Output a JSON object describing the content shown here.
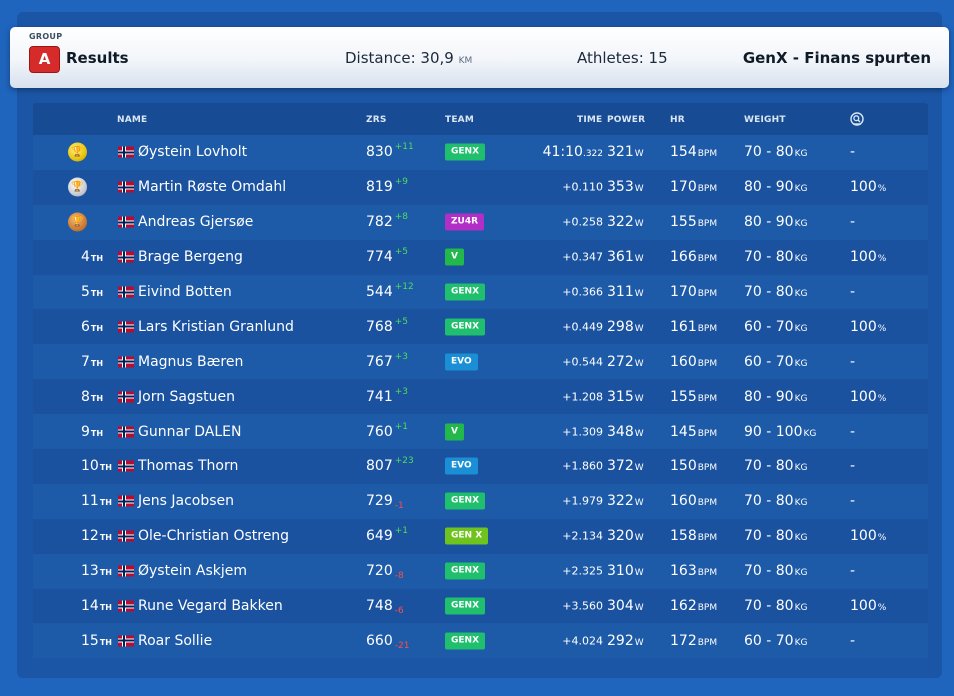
{
  "header": {
    "group_label": "GROUP",
    "group_letter": "A",
    "title": "Results",
    "distance_label": "Distance: 30,9",
    "distance_unit": "KM",
    "athletes_label": "Athletes: 15",
    "event_name": "GenX - Finans spurten"
  },
  "columns": {
    "name": "NAME",
    "zrs": "ZRS",
    "team": "TEAM",
    "time": "TIME",
    "power": "POWER",
    "hr": "HR",
    "weight": "WEIGHT",
    "extra_icon": "zoom-icon"
  },
  "units": {
    "power": "W",
    "hr": "BPM",
    "weight": "KG",
    "pct": "%"
  },
  "team_colors": {
    "GENX": "#1fbf6e",
    "ZU4R": "#b22fc7",
    "V": "#22b84c",
    "EVO": "#1a8fd6",
    "GEN X": "#6ec41d"
  },
  "rows": [
    {
      "pos": "",
      "sfx": "",
      "medal": "gold",
      "name": "Øystein Lovholt",
      "zrs": "830",
      "delta": "+11",
      "dir": "up",
      "team": "GENX",
      "time_main": "41:10",
      "time_ms": ".322",
      "gap": "",
      "power": "321",
      "hr": "154",
      "weight": "70 - 80",
      "pct": "-",
      "pct_unit": ""
    },
    {
      "pos": "",
      "sfx": "",
      "medal": "silver",
      "name": "Martin Røste Omdahl",
      "zrs": "819",
      "delta": "+9",
      "dir": "up",
      "team": "",
      "time_main": "",
      "time_ms": "",
      "gap": "+0.110",
      "power": "353",
      "hr": "170",
      "weight": "80 - 90",
      "pct": "100",
      "pct_unit": "%"
    },
    {
      "pos": "",
      "sfx": "",
      "medal": "bronze",
      "name": "Andreas Gjersøe",
      "zrs": "782",
      "delta": "+8",
      "dir": "up",
      "team": "ZU4R",
      "time_main": "",
      "time_ms": "",
      "gap": "+0.258",
      "power": "322",
      "hr": "155",
      "weight": "80 - 90",
      "pct": "-",
      "pct_unit": ""
    },
    {
      "pos": "4",
      "sfx": "TH",
      "medal": "",
      "name": "Brage Bergeng",
      "zrs": "774",
      "delta": "+5",
      "dir": "up",
      "team": "V",
      "time_main": "",
      "time_ms": "",
      "gap": "+0.347",
      "power": "361",
      "hr": "166",
      "weight": "70 - 80",
      "pct": "100",
      "pct_unit": "%"
    },
    {
      "pos": "5",
      "sfx": "TH",
      "medal": "",
      "name": "Eivind Botten",
      "zrs": "544",
      "delta": "+12",
      "dir": "up",
      "team": "GENX",
      "time_main": "",
      "time_ms": "",
      "gap": "+0.366",
      "power": "311",
      "hr": "170",
      "weight": "70 - 80",
      "pct": "-",
      "pct_unit": ""
    },
    {
      "pos": "6",
      "sfx": "TH",
      "medal": "",
      "name": "Lars Kristian Granlund",
      "zrs": "768",
      "delta": "+5",
      "dir": "up",
      "team": "GENX",
      "time_main": "",
      "time_ms": "",
      "gap": "+0.449",
      "power": "298",
      "hr": "161",
      "weight": "60 - 70",
      "pct": "100",
      "pct_unit": "%"
    },
    {
      "pos": "7",
      "sfx": "TH",
      "medal": "",
      "name": "Magnus Bæren",
      "zrs": "767",
      "delta": "+3",
      "dir": "up",
      "team": "EVO",
      "time_main": "",
      "time_ms": "",
      "gap": "+0.544",
      "power": "272",
      "hr": "160",
      "weight": "60 - 70",
      "pct": "-",
      "pct_unit": ""
    },
    {
      "pos": "8",
      "sfx": "TH",
      "medal": "",
      "name": "Jorn Sagstuen",
      "zrs": "741",
      "delta": "+3",
      "dir": "up",
      "team": "",
      "time_main": "",
      "time_ms": "",
      "gap": "+1.208",
      "power": "315",
      "hr": "155",
      "weight": "80 - 90",
      "pct": "100",
      "pct_unit": "%"
    },
    {
      "pos": "9",
      "sfx": "TH",
      "medal": "",
      "name": "Gunnar DALEN",
      "zrs": "760",
      "delta": "+1",
      "dir": "up",
      "team": "V",
      "time_main": "",
      "time_ms": "",
      "gap": "+1.309",
      "power": "348",
      "hr": "145",
      "weight": "90 - 100",
      "pct": "-",
      "pct_unit": ""
    },
    {
      "pos": "10",
      "sfx": "TH",
      "medal": "",
      "name": "Thomas Thorn",
      "zrs": "807",
      "delta": "+23",
      "dir": "up",
      "team": "EVO",
      "time_main": "",
      "time_ms": "",
      "gap": "+1.860",
      "power": "372",
      "hr": "150",
      "weight": "70 - 80",
      "pct": "-",
      "pct_unit": ""
    },
    {
      "pos": "11",
      "sfx": "TH",
      "medal": "",
      "name": "Jens Jacobsen",
      "zrs": "729",
      "delta": "-1",
      "dir": "down",
      "team": "GENX",
      "time_main": "",
      "time_ms": "",
      "gap": "+1.979",
      "power": "322",
      "hr": "160",
      "weight": "70 - 80",
      "pct": "-",
      "pct_unit": ""
    },
    {
      "pos": "12",
      "sfx": "TH",
      "medal": "",
      "name": "Ole-Christian Ostreng",
      "zrs": "649",
      "delta": "+1",
      "dir": "up",
      "team": "GEN X",
      "time_main": "",
      "time_ms": "",
      "gap": "+2.134",
      "power": "320",
      "hr": "158",
      "weight": "70 - 80",
      "pct": "100",
      "pct_unit": "%"
    },
    {
      "pos": "13",
      "sfx": "TH",
      "medal": "",
      "name": "Øystein Askjem",
      "zrs": "720",
      "delta": "-8",
      "dir": "down",
      "team": "GENX",
      "time_main": "",
      "time_ms": "",
      "gap": "+2.325",
      "power": "310",
      "hr": "163",
      "weight": "70 - 80",
      "pct": "-",
      "pct_unit": ""
    },
    {
      "pos": "14",
      "sfx": "TH",
      "medal": "",
      "name": "Rune Vegard Bakken",
      "zrs": "748",
      "delta": "-6",
      "dir": "down",
      "team": "GENX",
      "time_main": "",
      "time_ms": "",
      "gap": "+3.560",
      "power": "304",
      "hr": "162",
      "weight": "70 - 80",
      "pct": "100",
      "pct_unit": "%"
    },
    {
      "pos": "15",
      "sfx": "TH",
      "medal": "",
      "name": "Roar Sollie",
      "zrs": "660",
      "delta": "-21",
      "dir": "down",
      "team": "GENX",
      "time_main": "",
      "time_ms": "",
      "gap": "+4.024",
      "power": "292",
      "hr": "172",
      "weight": "60 - 70",
      "pct": "-",
      "pct_unit": ""
    }
  ]
}
